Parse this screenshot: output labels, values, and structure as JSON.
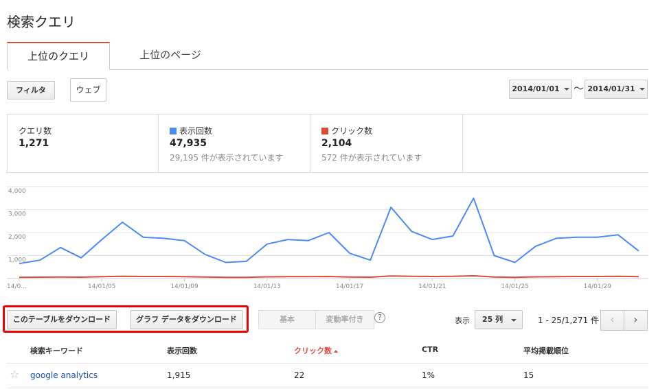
{
  "page": {
    "title": "検索クエリ"
  },
  "tabs": [
    {
      "label": "上位のクエリ",
      "active": true
    },
    {
      "label": "上位のページ",
      "active": false
    }
  ],
  "toolbar": {
    "filter_label": "フィルタ",
    "web_label": "ウェブ",
    "date_start": "2014/01/01",
    "date_separator": "〜",
    "date_end": "2014/01/31"
  },
  "stats": [
    {
      "label": "クエリ数",
      "value": "1,271",
      "sub": "",
      "color": ""
    },
    {
      "label": "表示回数",
      "value": "47,935",
      "sub": "29,195 件が表示されています",
      "color": "#4a8af4"
    },
    {
      "label": "クリック数",
      "value": "2,104",
      "sub": "572 件が表示されています",
      "color": "#dd4b39"
    }
  ],
  "chart_data": {
    "type": "line",
    "x": [
      "14/01/01",
      "14/01/02",
      "14/01/03",
      "14/01/04",
      "14/01/05",
      "14/01/06",
      "14/01/07",
      "14/01/08",
      "14/01/09",
      "14/01/10",
      "14/01/11",
      "14/01/12",
      "14/01/13",
      "14/01/14",
      "14/01/15",
      "14/01/16",
      "14/01/17",
      "14/01/18",
      "14/01/19",
      "14/01/20",
      "14/01/21",
      "14/01/22",
      "14/01/23",
      "14/01/24",
      "14/01/25",
      "14/01/26",
      "14/01/27",
      "14/01/28",
      "14/01/29",
      "14/01/30",
      "14/01/31"
    ],
    "series": [
      {
        "name": "表示回数",
        "color": "#4a8af4",
        "values": [
          650,
          800,
          1350,
          900,
          1700,
          2450,
          1800,
          1750,
          1650,
          1050,
          700,
          750,
          1500,
          1700,
          1650,
          2000,
          1100,
          800,
          3100,
          2050,
          1700,
          1850,
          3500,
          1000,
          700,
          1400,
          1750,
          1800,
          1800,
          1900,
          1200
        ]
      },
      {
        "name": "クリック数",
        "color": "#dd4b39",
        "values": [
          50,
          60,
          70,
          60,
          80,
          100,
          90,
          90,
          85,
          70,
          50,
          55,
          75,
          85,
          80,
          90,
          70,
          60,
          110,
          100,
          90,
          95,
          120,
          70,
          55,
          75,
          85,
          90,
          90,
          95,
          80
        ]
      }
    ],
    "ylim": [
      0,
      4000
    ],
    "yticks": [
      "4,000",
      "3,000",
      "2,000",
      "1,000"
    ],
    "xticks": [
      "14/0...",
      "14/01/05",
      "14/01/09",
      "14/01/13",
      "14/01/17",
      "14/01/21",
      "14/01/25",
      "14/01/29"
    ],
    "grid": true
  },
  "download": {
    "table_label": "このテーブルをダウンロード",
    "chart_label": "グラフ データをダウンロード"
  },
  "view_toggle": {
    "basic": "基本",
    "change": "変動率付き",
    "help": "?"
  },
  "pagination": {
    "show_label": "表示",
    "rows_value": "25 列",
    "range": "1 - 25/1,271 件",
    "prev": "‹",
    "next": "›"
  },
  "table": {
    "headers": [
      "検索キーワード",
      "表示回数",
      "クリック数",
      "CTR",
      "平均掲載順位"
    ],
    "rows": [
      {
        "query": "google analytics",
        "impressions": "1,915",
        "clicks": "22",
        "ctr": "1%",
        "position": "15"
      }
    ]
  }
}
